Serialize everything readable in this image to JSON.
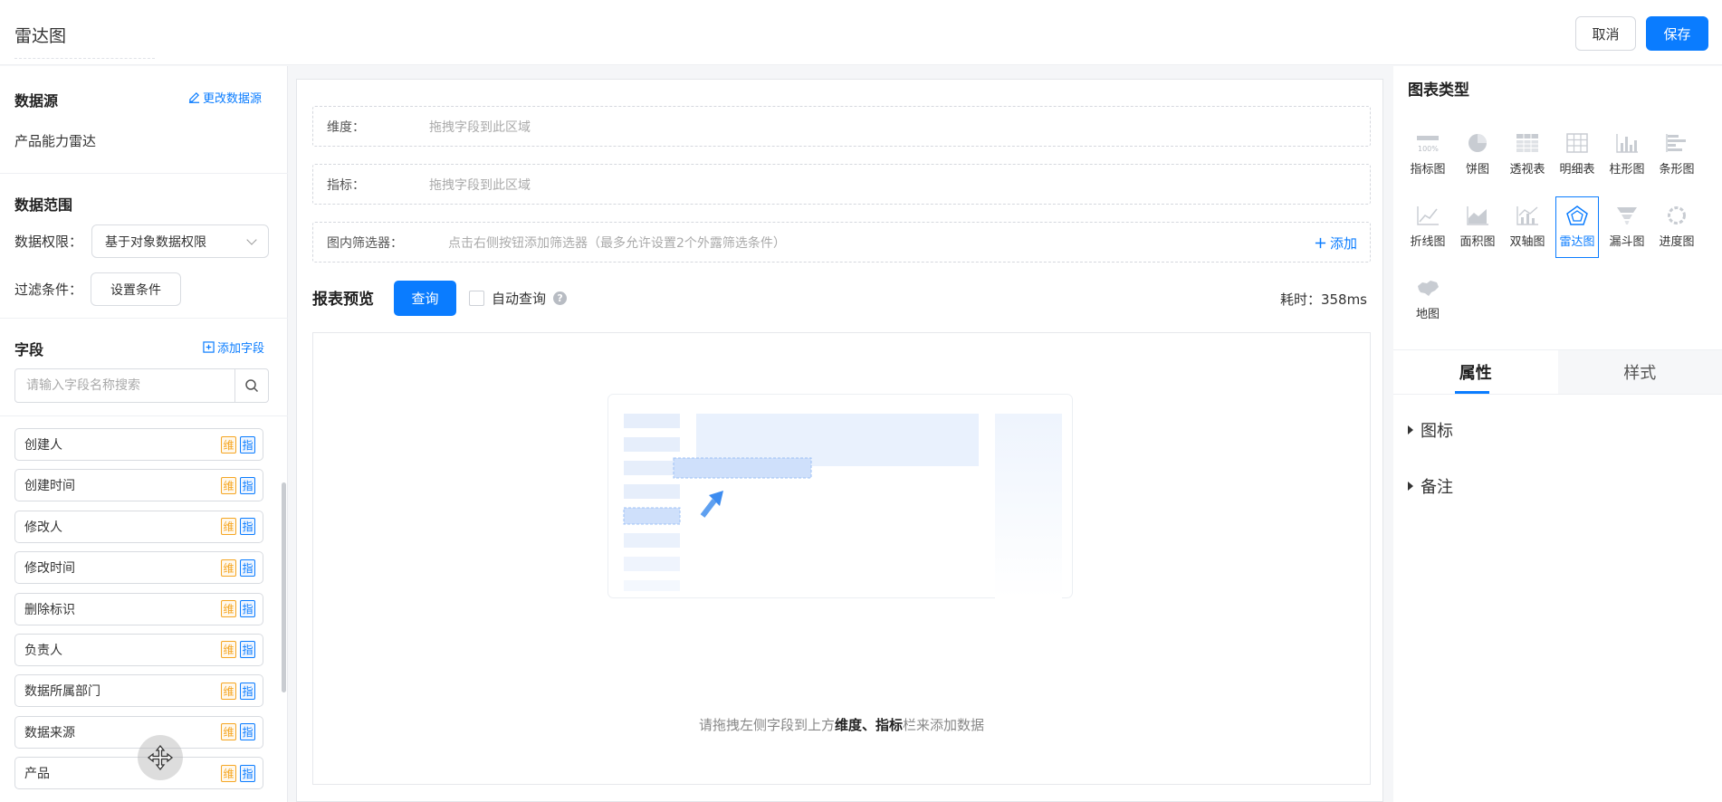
{
  "header": {
    "title": "雷达图",
    "cancel_label": "取消",
    "save_label": "保存"
  },
  "left": {
    "datasource_title": "数据源",
    "change_datasource": "更改数据源",
    "datasource_name": "产品能力雷达",
    "scope_title": "数据范围",
    "permission_label": "数据权限：",
    "permission_value": "基于对象数据权限",
    "filter_label": "过滤条件：",
    "filter_button": "设置条件",
    "fields_title": "字段",
    "add_field": "添加字段",
    "search_placeholder": "请输入字段名称搜索",
    "tag_dimension": "维",
    "tag_metric": "指",
    "fields": [
      "创建人",
      "创建时间",
      "修改人",
      "修改时间",
      "删除标识",
      "负责人",
      "数据所属部门",
      "数据来源",
      "产品"
    ]
  },
  "middle": {
    "dimension_label": "维度：",
    "dimension_hint": "拖拽字段到此区域",
    "metric_label": "指标：",
    "metric_hint": "拖拽字段到此区域",
    "filter_label": "图内筛选器：",
    "filter_hint": "点击右侧按钮添加筛选器（最多允许设置2个外露筛选条件）",
    "add_label": "添加",
    "preview_title": "报表预览",
    "query_label": "查询",
    "auto_query_label": "自动查询",
    "elapsed": "耗时：358ms",
    "empty_prefix": "请拖拽左侧字段到上方",
    "empty_bold": "维度、指标",
    "empty_suffix": "栏来添加数据"
  },
  "right": {
    "chart_type_title": "图表类型",
    "types": [
      "指标图",
      "饼图",
      "透视表",
      "明细表",
      "柱形图",
      "条形图",
      "折线图",
      "面积图",
      "双轴图",
      "雷达图",
      "漏斗图",
      "进度图",
      "地图"
    ],
    "active_type": "雷达图",
    "tab_properties": "属性",
    "tab_style": "样式",
    "section_icon": "图标",
    "section_note": "备注"
  },
  "colors": {
    "primary": "#0a7cff",
    "dimension_tag": "#f5a623"
  }
}
